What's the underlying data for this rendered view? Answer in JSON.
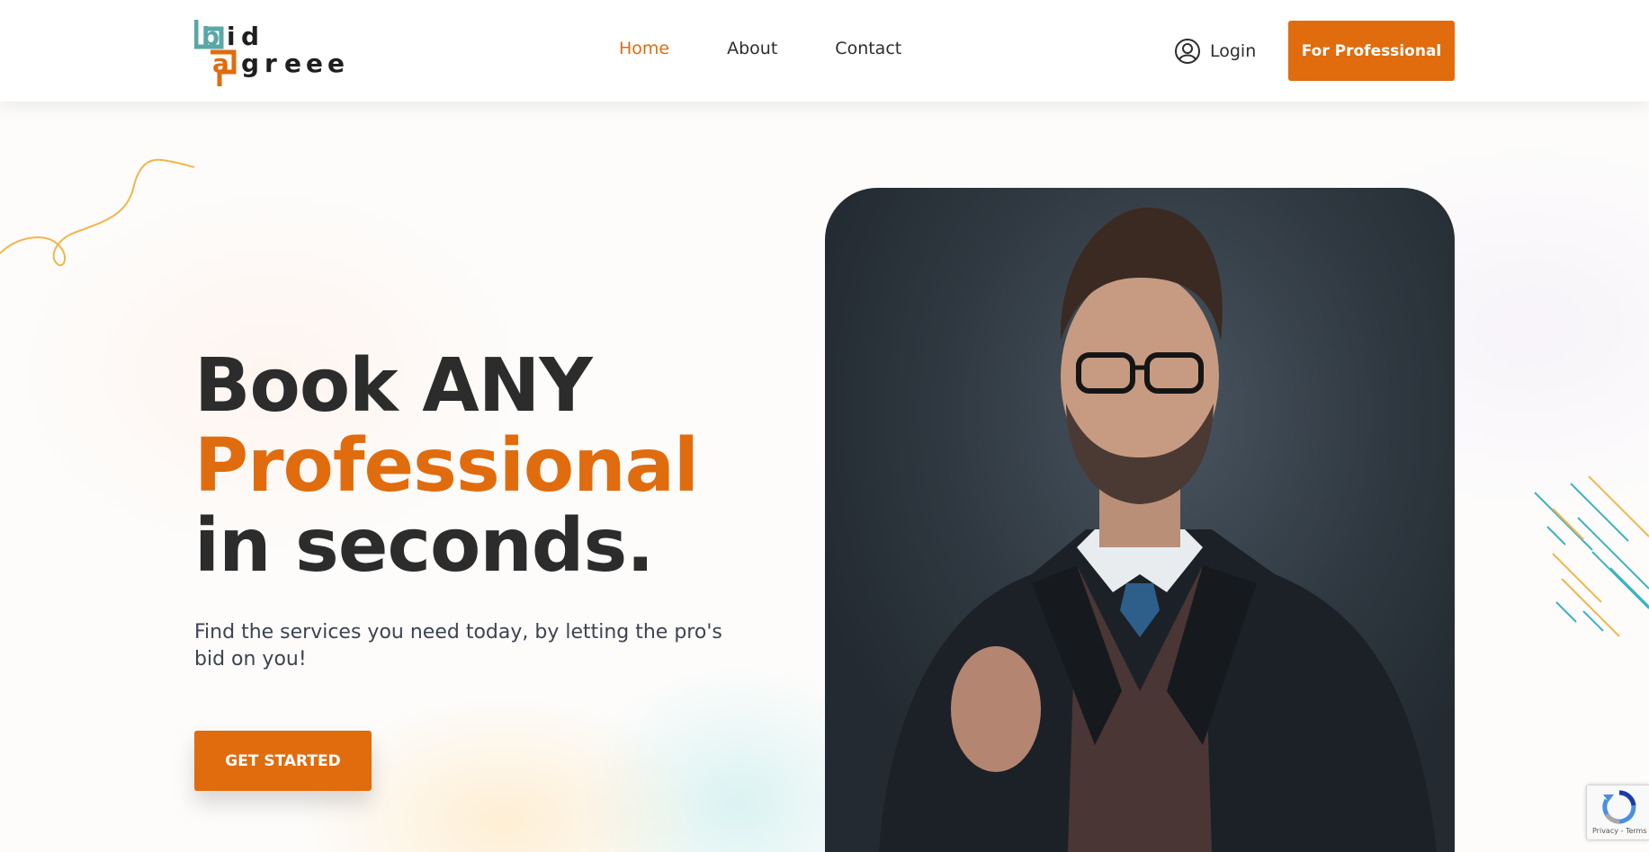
{
  "brand": {
    "logo_text": "bidagree",
    "colors": {
      "orange": "#e06c0e",
      "teal": "#5aa7a6",
      "dark": "#2c2c2c"
    }
  },
  "nav": {
    "items": [
      {
        "label": "Home",
        "active": true
      },
      {
        "label": "About",
        "active": false
      },
      {
        "label": "Contact",
        "active": false
      }
    ]
  },
  "header": {
    "login_label": "Login",
    "login_icon": "user-circle-icon",
    "pro_button_label": "For Professional"
  },
  "hero": {
    "title_line1": "Book ANY",
    "title_line2": "Professional",
    "title_line3": "in seconds.",
    "subtitle": "Find the services you need today, by letting the pro's bid on you!",
    "cta_label": "GET STARTED",
    "image_alt": "man-in-suit-photo"
  },
  "recaptcha": {
    "terms": "Privacy - Terms",
    "icon": "recaptcha-icon"
  }
}
